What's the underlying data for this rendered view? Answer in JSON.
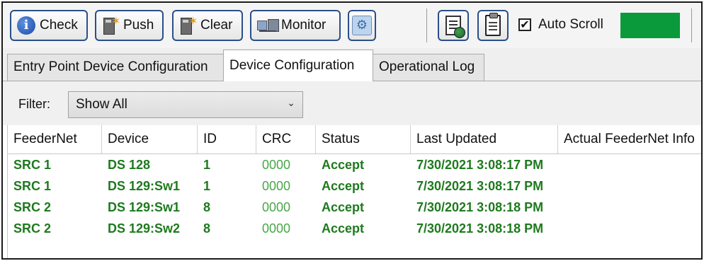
{
  "toolbar": {
    "check_label": "Check",
    "push_label": "Push",
    "clear_label": "Clear",
    "monitor_label": "Monitor",
    "auto_scroll_label": "Auto Scroll",
    "auto_scroll_checked": true,
    "status_color": "#0a9a3c"
  },
  "tabs": [
    {
      "label": "Entry Point Device Configuration",
      "active": false
    },
    {
      "label": "Device Configuration",
      "active": true
    },
    {
      "label": "Operational Log",
      "active": false
    }
  ],
  "filter": {
    "label": "Filter:",
    "selected": "Show All"
  },
  "table": {
    "columns": [
      "FeederNet",
      "Device",
      "ID",
      "CRC",
      "Status",
      "Last Updated",
      "Actual FeederNet Info"
    ],
    "rows": [
      [
        "SRC 1",
        "DS 128",
        "1",
        "0000",
        "Accept",
        "7/30/2021 3:08:17 PM"
      ],
      [
        "SRC 1",
        "DS 129:Sw1",
        "1",
        "0000",
        "Accept",
        "7/30/2021 3:08:17 PM"
      ],
      [
        "SRC 2",
        "DS 129:Sw1",
        "8",
        "0000",
        "Accept",
        "7/30/2021 3:08:18 PM"
      ],
      [
        "SRC 2",
        "DS 129:Sw2",
        "8",
        "0000",
        "Accept",
        "7/30/2021 3:08:18 PM"
      ]
    ],
    "text_color": "#1e7a1e"
  }
}
